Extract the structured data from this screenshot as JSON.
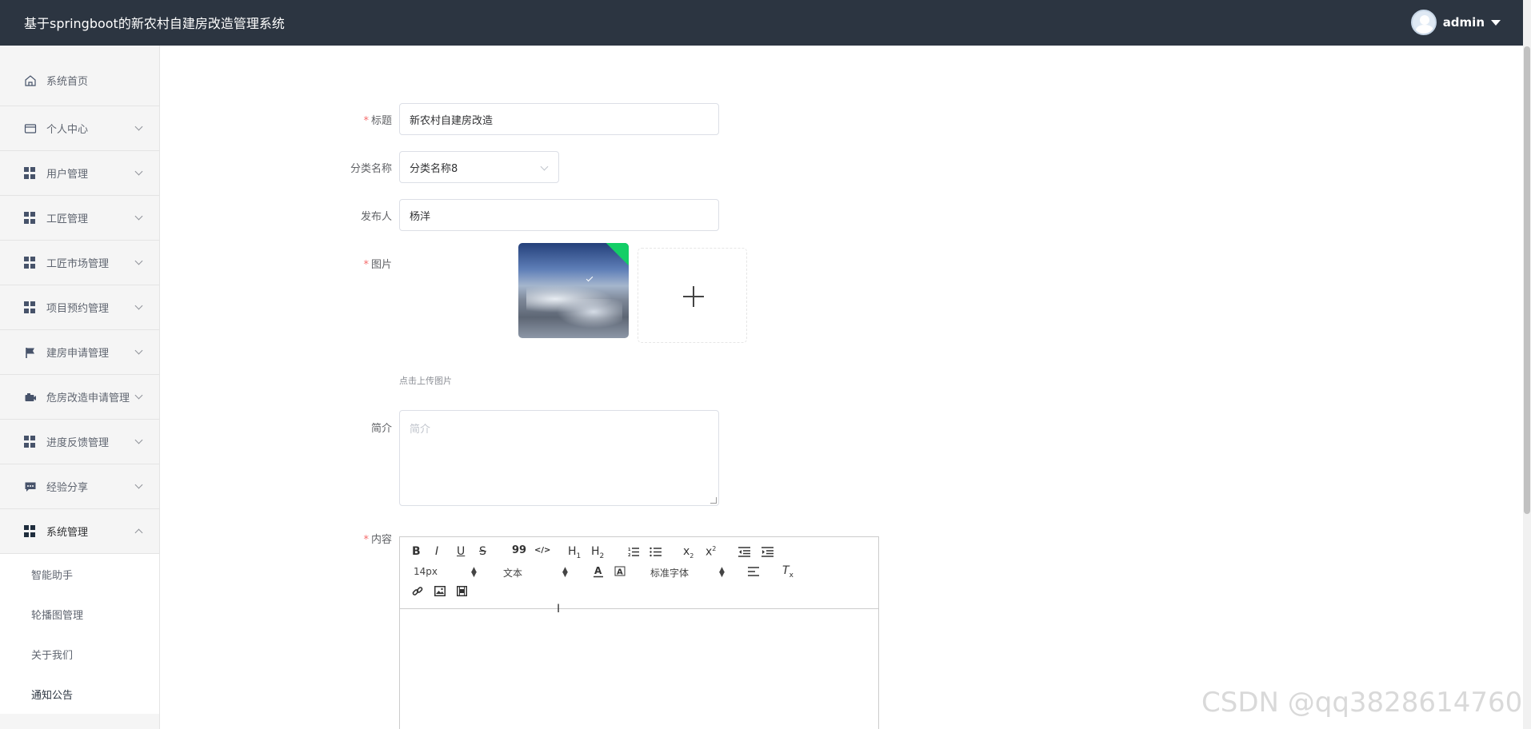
{
  "app": {
    "title": "基于springboot的新农村自建房改造管理系统"
  },
  "user": {
    "name": "admin"
  },
  "sidebar": {
    "items": [
      {
        "label": "系统首页",
        "icon": "home-icon"
      },
      {
        "label": "个人中心",
        "icon": "credit-card-icon"
      },
      {
        "label": "用户管理",
        "icon": "grid-icon"
      },
      {
        "label": "工匠管理",
        "icon": "grid-icon"
      },
      {
        "label": "工匠市场管理",
        "icon": "grid-icon"
      },
      {
        "label": "项目预约管理",
        "icon": "grid-icon"
      },
      {
        "label": "建房申请管理",
        "icon": "flag-icon"
      },
      {
        "label": "危房改造申请管理",
        "icon": "camera-icon"
      },
      {
        "label": "进度反馈管理",
        "icon": "grid-icon"
      },
      {
        "label": "经验分享",
        "icon": "chat-icon"
      },
      {
        "label": "系统管理",
        "icon": "grid-icon"
      }
    ],
    "subitems": [
      {
        "label": "智能助手"
      },
      {
        "label": "轮播图管理"
      },
      {
        "label": "关于我们"
      },
      {
        "label": "通知公告"
      }
    ]
  },
  "form": {
    "title_label": "标题",
    "title_value": "新农村自建房改造",
    "category_label": "分类名称",
    "category_value": "分类名称8",
    "publisher_label": "发布人",
    "publisher_value": "杨洋",
    "image_label": "图片",
    "upload_tip": "点击上传图片",
    "summary_label": "简介",
    "summary_placeholder": "简介",
    "content_label": "内容"
  },
  "editor": {
    "font_size": "14px",
    "paragraph": "文本",
    "font_family": "标准字体",
    "buttons": [
      "B",
      "I",
      "U",
      "S",
      "99",
      "</>",
      "H1",
      "H2",
      "ol",
      "ul",
      "x2",
      "x2",
      "outdent",
      "indent",
      "color",
      "bg",
      "align",
      "clear",
      "link",
      "image",
      "video"
    ]
  },
  "watermark": "CSDN @qq3828614760"
}
